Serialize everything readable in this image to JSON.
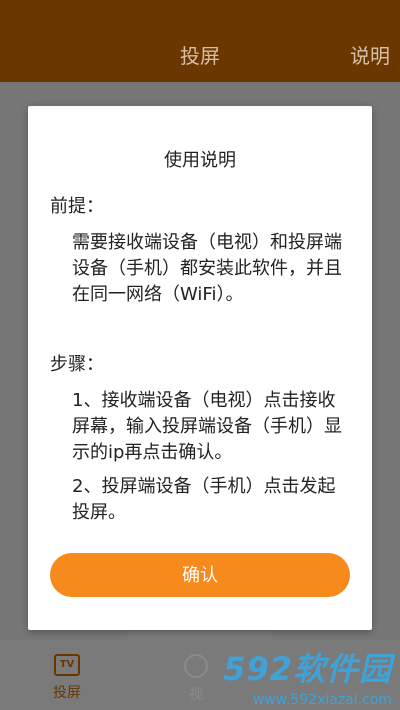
{
  "header": {
    "title": "投屏",
    "help_label": "说明"
  },
  "tabs": [
    {
      "icon_text": "TV",
      "label": "投屏",
      "icon": "tv-icon",
      "active": true
    },
    {
      "label": "视",
      "icon": "camera-icon",
      "active": false
    }
  ],
  "watermark": {
    "brand": "592软件园",
    "url": "www.592xiazai.com"
  },
  "dialog": {
    "title": "使用说明",
    "premise_label": "前提：",
    "premise_text": "需要接收端设备（电视）和投屏端设备（手机）都安装此软件，并且在同一网络（WiFi）。",
    "steps_label": "步骤：",
    "step1": "1、接收端设备（电视）点击接收屏幕，输入投屏端设备（手机）显示的ip再点击确认。",
    "step2": "2、投屏端设备（手机）点击发起投屏。",
    "confirm_label": "确认"
  },
  "colors": {
    "header_bg": "#6b3700",
    "accent": "#f78a1d",
    "watermark": "#3fa3d8"
  }
}
